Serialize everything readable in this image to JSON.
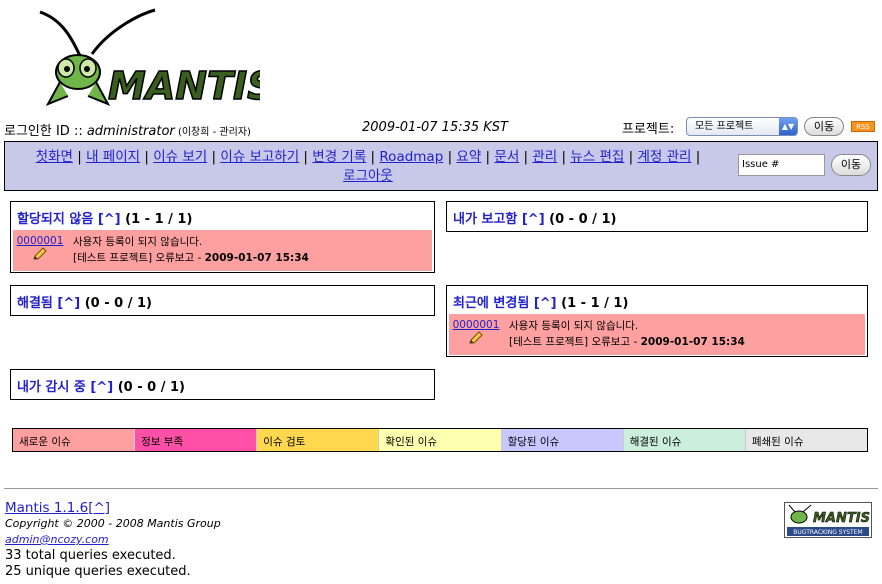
{
  "logo_text": "MANTIS",
  "login": {
    "label": "로그인한 ID :: ",
    "user": "administrator",
    "realname": " (이창희 - 관리자)",
    "datetime": "2009-01-07 15:35 KST",
    "project_label": "프로젝트:",
    "project_selected": "모든 프로젝트",
    "go": "이동",
    "rss": "RSS"
  },
  "menu": {
    "items": [
      "첫화면",
      "내 페이지",
      "이슈 보기",
      "이슈 보고하기",
      "변경 기록",
      "Roadmap",
      "요약",
      "문서",
      "관리",
      "뉴스 편집",
      "계정 관리",
      "로그아웃"
    ],
    "separator": " | ",
    "issue_placeholder": "Issue #",
    "go": "이동"
  },
  "boxes": {
    "unassigned": {
      "title": "할당되지 않음",
      "link": "[^]",
      "count": " (1 - 1 / 1)"
    },
    "reported": {
      "title": "내가 보고함",
      "link": "[^]",
      "count": " (0 - 0 / 1)"
    },
    "resolved": {
      "title": "해결됨",
      "link": "[^]",
      "count": " (0 - 0 / 1)"
    },
    "recent": {
      "title": "최근에 변경됨",
      "link": "[^]",
      "count": " (1 - 1 / 1)"
    },
    "monitored": {
      "title": "내가 감시 중",
      "link": "[^]",
      "count": " (0 - 0 / 1)"
    }
  },
  "issue": {
    "id": "0000001",
    "summary": "사용자 등록이 되지 않습니다.",
    "meta": "[테스트 프로젝트] 오류보고 - ",
    "updated": "2009-01-07 15:34",
    "row_color": "#ffa0a0"
  },
  "legend": [
    {
      "label": "새로운 이슈",
      "color": "#ffa0a0"
    },
    {
      "label": "정보 부족",
      "color": "#ff50a8"
    },
    {
      "label": "이슈 검토",
      "color": "#ffd850"
    },
    {
      "label": "확인된 이슈",
      "color": "#ffffb0"
    },
    {
      "label": "할당된 이슈",
      "color": "#c8c8ff"
    },
    {
      "label": "해결된 이슈",
      "color": "#cceedd"
    },
    {
      "label": "폐쇄된 이슈",
      "color": "#e8e8e8"
    }
  ],
  "footer": {
    "version": "Mantis 1.1.6",
    "version_link": "[^]",
    "copyright": "Copyright © 2000 - 2008 Mantis Group",
    "email": "admin@ncozy.com",
    "total_queries": "33 total queries executed.",
    "unique_queries": "25 unique queries executed.",
    "badge_top": "MANTIS",
    "badge_bottom": "BUGTRACKING SYSTEM"
  }
}
